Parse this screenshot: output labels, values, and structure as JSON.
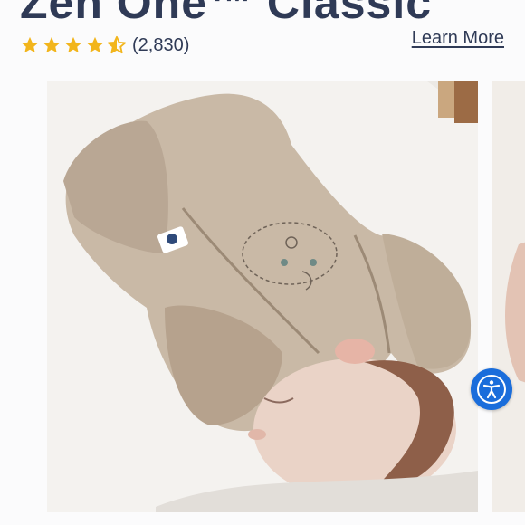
{
  "product": {
    "title": "Zen One™ Classic",
    "rating_value": 4.5,
    "review_count": "(2,830)",
    "learn_more_label": "Learn More",
    "star_color": "#f2b51c"
  },
  "gallery": {
    "main_image_icon": "baby-in-sleep-sack-photo",
    "next_image_icon": "next-product-photo-preview"
  },
  "accessibility": {
    "icon": "accessibility-icon",
    "button_color": "#1a6ddb"
  }
}
